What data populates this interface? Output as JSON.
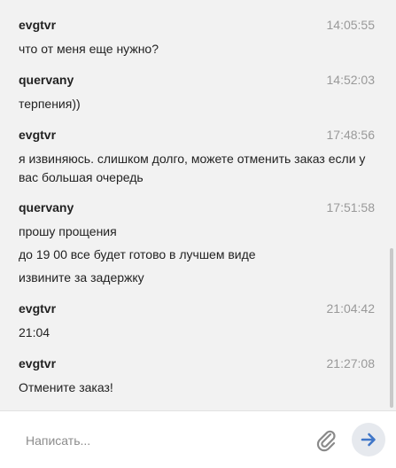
{
  "messages": [
    {
      "author": "evgtvr",
      "time": "14:05:55",
      "lines": [
        "что от меня еще нужно?"
      ]
    },
    {
      "author": "quervany",
      "time": "14:52:03",
      "lines": [
        "терпения))"
      ]
    },
    {
      "author": "evgtvr",
      "time": "17:48:56",
      "lines": [
        "я извиняюсь. слишком долго, можете отменить заказ если у вас большая очередь"
      ]
    },
    {
      "author": "quervany",
      "time": "17:51:58",
      "lines": [
        "прошу прощения",
        "до 19 00 все будет готово в лучшем виде",
        "извините за задержку"
      ]
    },
    {
      "author": "evgtvr",
      "time": "21:04:42",
      "lines": [
        "21:04"
      ]
    },
    {
      "author": "evgtvr",
      "time": "21:27:08",
      "lines": [
        "Отмените заказ!"
      ]
    }
  ],
  "composer": {
    "placeholder": "Написать...",
    "attach_icon": "paperclip-icon",
    "send_icon": "arrow-right-icon",
    "send_color": "#3f76c8"
  }
}
